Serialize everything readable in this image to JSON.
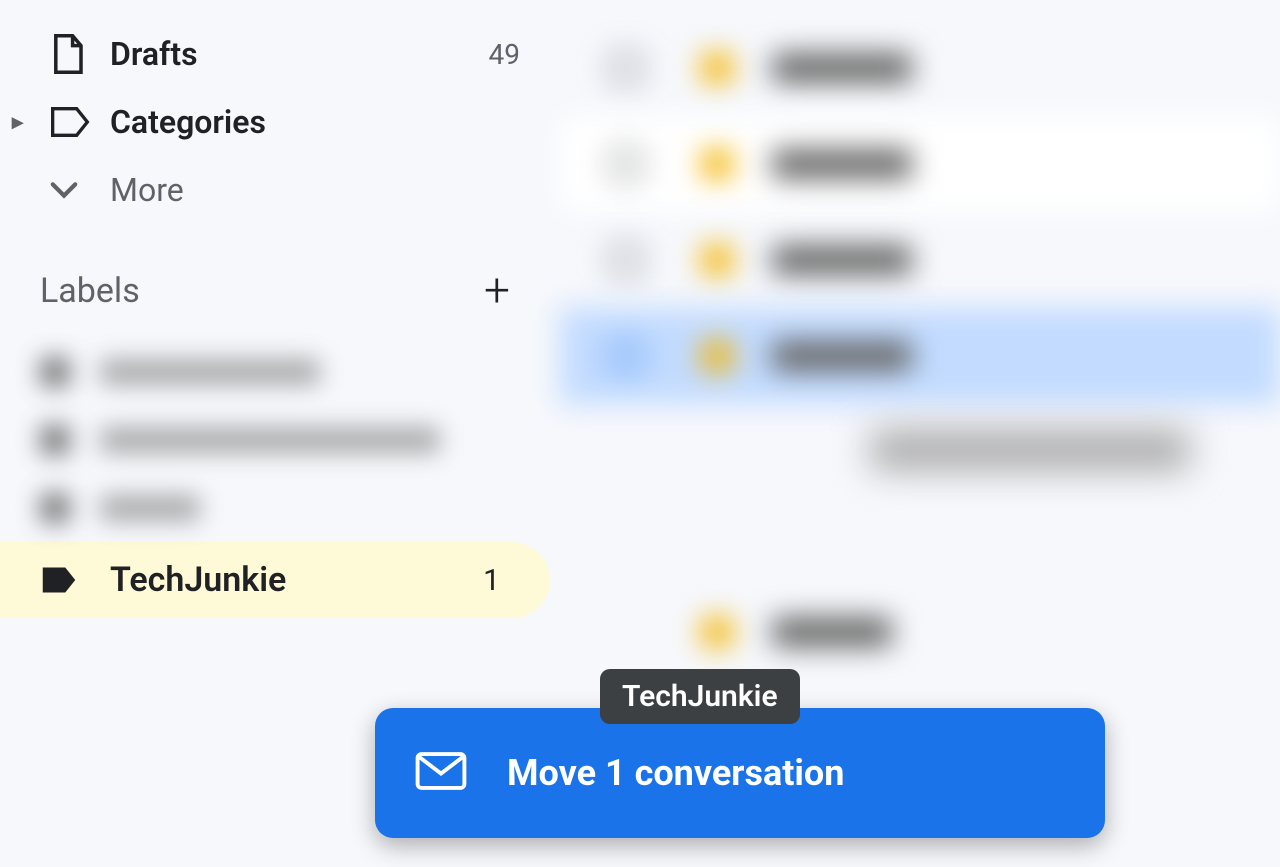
{
  "sidebar": {
    "nav_items": [
      {
        "label": "Drafts",
        "count": "49"
      },
      {
        "label": "Categories",
        "count": ""
      },
      {
        "label": "More",
        "count": ""
      }
    ],
    "labels_header": "Labels",
    "label_item": {
      "name": "TechJunkie",
      "count": "1"
    }
  },
  "drag": {
    "tooltip": "TechJunkie",
    "card_text": "Move 1 conversation"
  }
}
